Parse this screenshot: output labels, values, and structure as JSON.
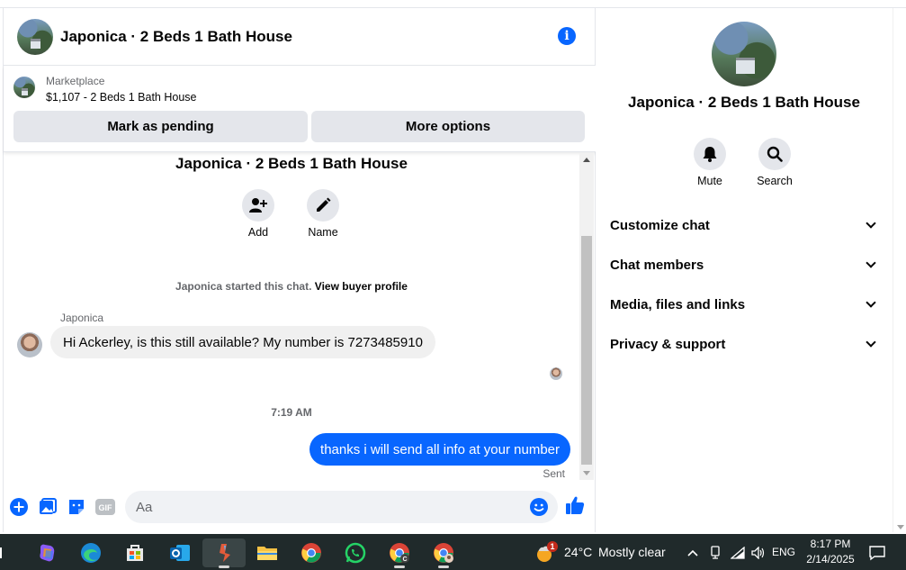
{
  "chat": {
    "title": "Japonica · 2 Beds 1 Bath House",
    "marketplace_label": "Marketplace",
    "marketplace_item": "$1,107 - 2 Beds 1 Bath House",
    "mark_pending_label": "Mark as pending",
    "more_options_label": "More options",
    "center_title": "Japonica · 2 Beds 1 Bath House",
    "add_label": "Add",
    "name_label": "Name",
    "started_text": "Japonica started this chat.",
    "buyer_profile_link": "View buyer profile",
    "sender_name": "Japonica",
    "incoming_message": "Hi Ackerley, is this still available? My number is 7273485910",
    "timestamp": "7:19 AM",
    "outgoing_message": "thanks i will send all info at your number",
    "sent_status": "Sent",
    "composer_placeholder": "Aa"
  },
  "details": {
    "title": "Japonica · 2 Beds 1 Bath House",
    "mute_label": "Mute",
    "search_label": "Search",
    "sections": [
      {
        "label": "Customize chat"
      },
      {
        "label": "Chat members"
      },
      {
        "label": "Media, files and links"
      },
      {
        "label": "Privacy & support"
      }
    ]
  },
  "taskbar": {
    "weather_badge": "1",
    "temperature": "24°C",
    "weather_text": "Mostly clear",
    "language": "ENG",
    "time": "8:17 PM",
    "date": "2/14/2025",
    "chrome_badge": "C"
  },
  "colors": {
    "accent": "#0866ff",
    "bubble_in": "#f0f0f0",
    "button_bg": "#e4e6eb",
    "taskbar_bg": "#202a2b"
  }
}
